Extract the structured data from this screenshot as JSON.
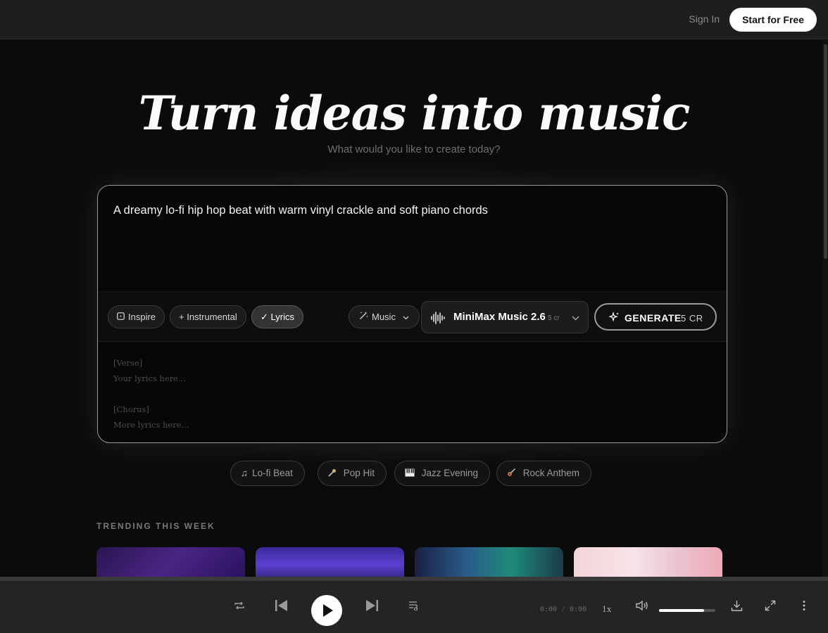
{
  "header": {
    "sign_in": "Sign In",
    "start_button": "Start for Free"
  },
  "hero": {
    "title": "Turn ideas into music",
    "subtitle": "What would you like to create today?"
  },
  "prompt": {
    "text": "A dreamy lo-fi hip hop beat with warm vinyl crackle and soft piano chords"
  },
  "controls": {
    "inspire": "Inspire",
    "instrumental": "+ Instrumental",
    "lyrics": "✓ Lyrics",
    "mode": "Music",
    "model_name": "MiniMax Music 2.6",
    "model_cost": "5 cr",
    "generate_label": "GENERATE",
    "generate_cost": "5 CR"
  },
  "lyrics_placeholder": {
    "line1": "[Verse]",
    "line2": "Your lyrics here...",
    "line3": "[Chorus]",
    "line4": "More lyrics here..."
  },
  "quick_prompts": [
    {
      "label": "Lo-fi Beat",
      "icon": "music-note-icon"
    },
    {
      "label": "Pop Hit",
      "icon": "microphone-icon"
    },
    {
      "label": "Jazz Evening",
      "icon": "piano-icon"
    },
    {
      "label": "Rock Anthem",
      "icon": "guitar-icon"
    }
  ],
  "trending": {
    "label": "TRENDING THIS WEEK"
  },
  "player": {
    "current_time": "0:00",
    "separator": "/",
    "duration": "0:00",
    "speed": "1x",
    "volume": 0.8
  },
  "colors": {
    "background": "#0b0b0b",
    "accent": "#ffffff",
    "panel_border": "#9a9a9a"
  }
}
